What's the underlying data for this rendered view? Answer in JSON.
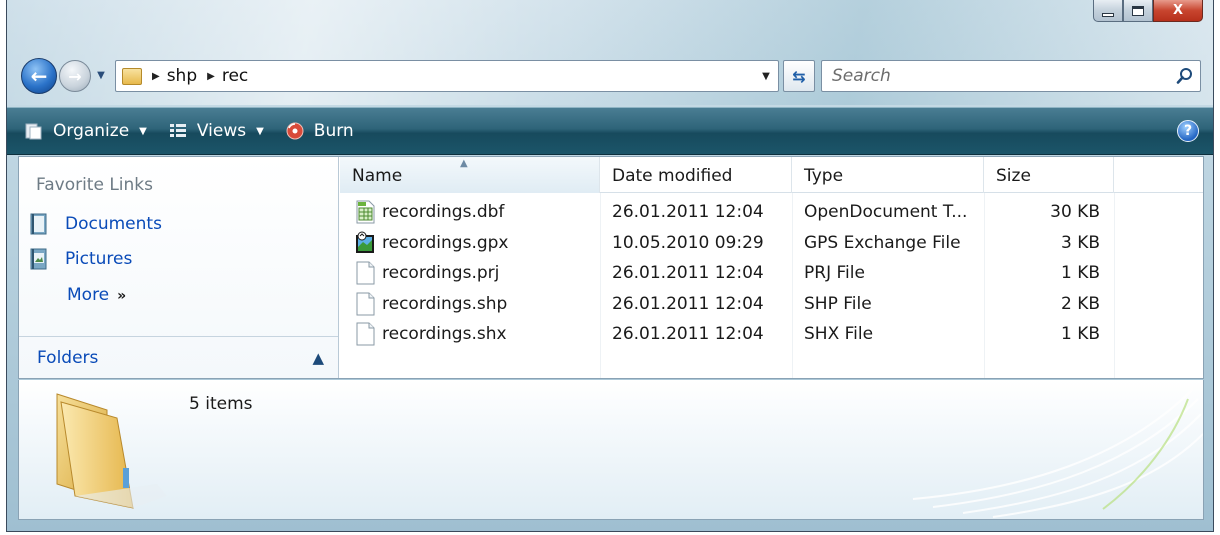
{
  "window": {
    "caption": {
      "min": "minimize",
      "max": "maximize",
      "close": "X"
    }
  },
  "address": {
    "crumbs": [
      "shp",
      "rec"
    ]
  },
  "search": {
    "placeholder": "Search"
  },
  "toolbar": {
    "organize_label": "Organize",
    "views_label": "Views",
    "burn_label": "Burn",
    "help_label": "?"
  },
  "nav_pane": {
    "favorite_links_title": "Favorite Links",
    "links": [
      {
        "label": "Documents"
      },
      {
        "label": "Pictures"
      }
    ],
    "more_label": "More",
    "more_glyph": "»",
    "folders_label": "Folders"
  },
  "columns": {
    "name": "Name",
    "date": "Date modified",
    "type": "Type",
    "size": "Size"
  },
  "files": [
    {
      "name": "recordings.dbf",
      "date": "26.01.2011 12:04",
      "type": "OpenDocument T...",
      "size": "30 KB",
      "icon": "spreadsheet-file-icon"
    },
    {
      "name": "recordings.gpx",
      "date": "10.05.2010 09:29",
      "type": "GPS Exchange File",
      "size": "3 KB",
      "icon": "gps-file-icon"
    },
    {
      "name": "recordings.prj",
      "date": "26.01.2011 12:04",
      "type": "PRJ File",
      "size": "1 KB",
      "icon": "generic-file-icon"
    },
    {
      "name": "recordings.shp",
      "date": "26.01.2011 12:04",
      "type": "SHP File",
      "size": "2 KB",
      "icon": "generic-file-icon"
    },
    {
      "name": "recordings.shx",
      "date": "26.01.2011 12:04",
      "type": "SHX File",
      "size": "1 KB",
      "icon": "generic-file-icon"
    }
  ],
  "details": {
    "item_count": "5 items"
  },
  "colors": {
    "link": "#0a4bb8",
    "command_bar": "#1b5569",
    "close_button": "#c8452f"
  }
}
